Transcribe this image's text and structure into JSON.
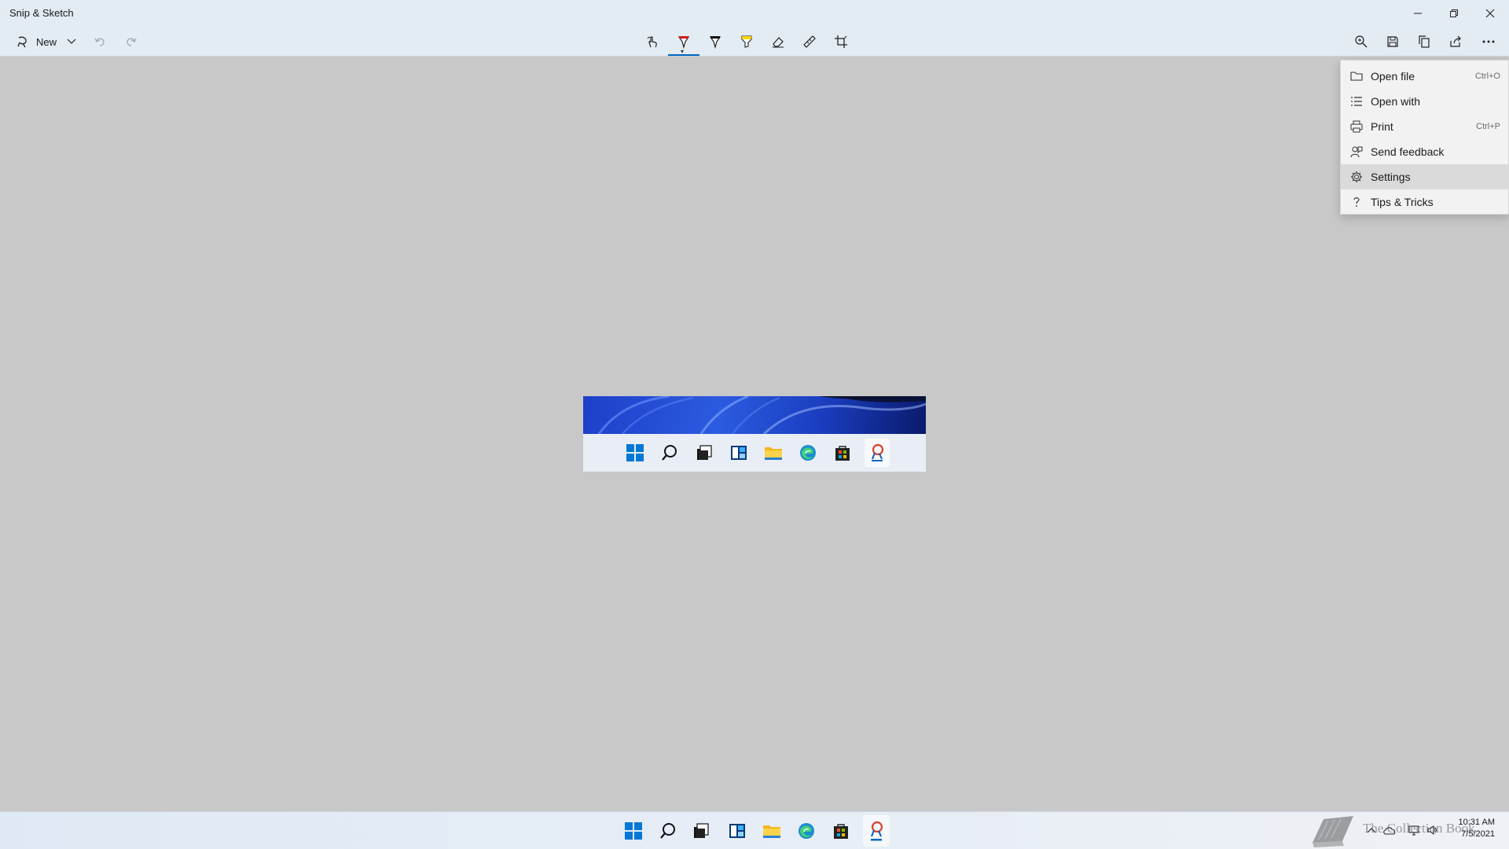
{
  "window": {
    "title": "Snip & Sketch"
  },
  "toolbar": {
    "new_label": "New",
    "tools": [
      "touch-writing-icon",
      "ballpoint-pen-icon",
      "pencil-icon",
      "highlighter-icon",
      "eraser-icon",
      "ruler-icon",
      "crop-icon"
    ],
    "right_tools": [
      "zoom-icon",
      "save-icon",
      "copy-icon",
      "share-icon",
      "more-icon"
    ]
  },
  "menu": {
    "items": [
      {
        "label": "Open file",
        "shortcut": "Ctrl+O",
        "icon": "folder-icon"
      },
      {
        "label": "Open with",
        "shortcut": "",
        "icon": "list-icon"
      },
      {
        "label": "Print",
        "shortcut": "Ctrl+P",
        "icon": "printer-icon"
      },
      {
        "label": "Send feedback",
        "shortcut": "",
        "icon": "feedback-icon"
      },
      {
        "label": "Settings",
        "shortcut": "",
        "icon": "gear-icon"
      },
      {
        "label": "Tips & Tricks",
        "shortcut": "",
        "icon": "question-icon"
      }
    ],
    "highlighted": "Settings"
  },
  "tray": {
    "time": "10:31 AM",
    "date": "7/5/2021"
  },
  "watermark": {
    "text": "The Collection Book"
  }
}
